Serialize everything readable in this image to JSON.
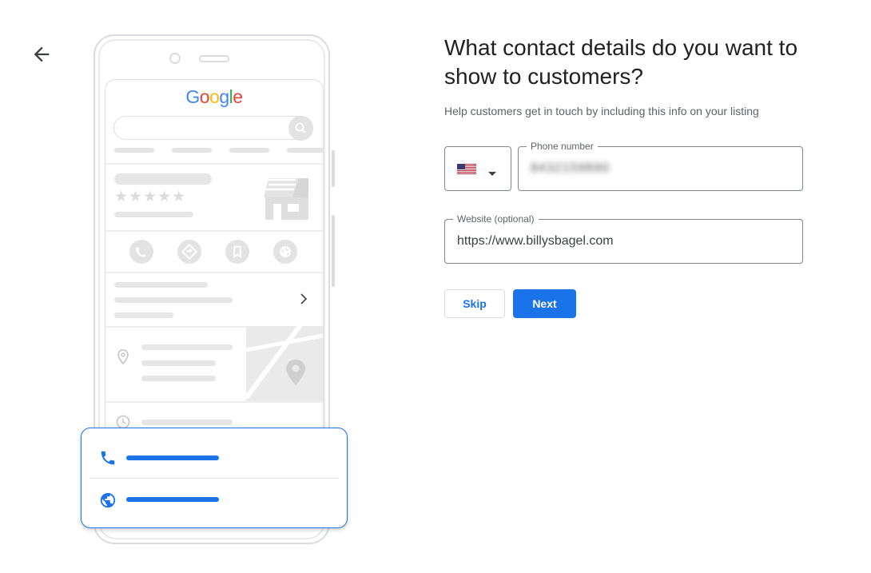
{
  "colors": {
    "accent": "#1a73e8",
    "text": "#202124",
    "muted": "#5f6368",
    "outline": "#80868b"
  },
  "nav": {
    "back_icon": "arrow-left-icon"
  },
  "illustration": {
    "logo": {
      "letters": [
        "G",
        "o",
        "o",
        "g",
        "l",
        "e"
      ],
      "colors": [
        "#4285f4",
        "#ea4335",
        "#fbbc05",
        "#4285f4",
        "#34a853",
        "#ea4335"
      ]
    },
    "rating_stars": "★★★★★",
    "icons": [
      "search-icon",
      "phone-icon",
      "directions-icon",
      "bookmark-icon",
      "globe-icon",
      "chevron-right-icon",
      "location-pin-icon",
      "clock-icon",
      "storefront-icon"
    ],
    "card_icons": [
      "phone-icon",
      "globe-icon"
    ]
  },
  "form": {
    "title": "What contact details do you want to show to customers?",
    "subtitle": "Help customers get in touch by including this info on your listing",
    "country": {
      "flag_icon": "us-flag-icon",
      "dropdown_icon": "caret-down-icon"
    },
    "phone": {
      "label": "Phone number",
      "value": "8432159890"
    },
    "website": {
      "label": "Website (optional)",
      "value": "https://www.billysbagel.com"
    },
    "skip_label": "Skip",
    "next_label": "Next"
  }
}
